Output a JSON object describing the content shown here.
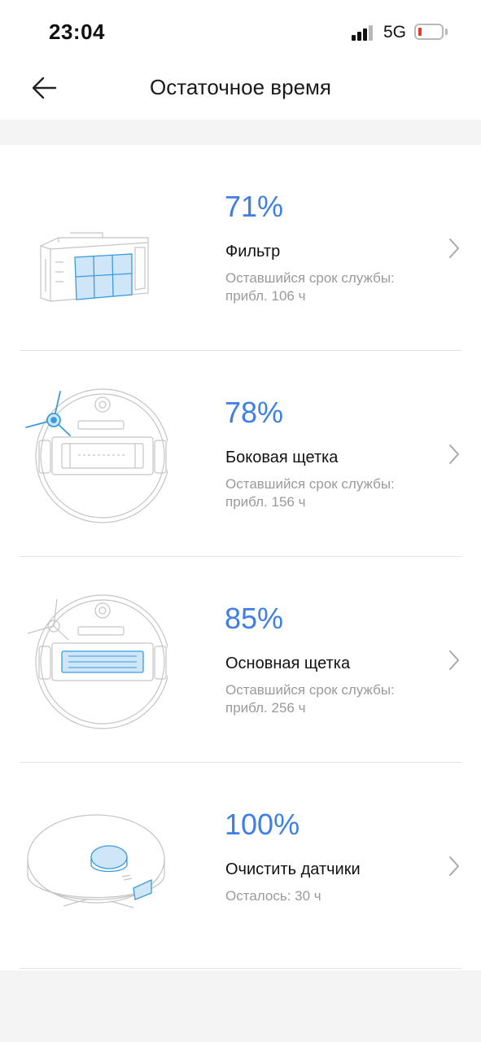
{
  "status_bar": {
    "time": "23:04",
    "network": "5G",
    "battery_level": 0.1,
    "battery_color": "#e23a2e"
  },
  "nav": {
    "title": "Остаточное время",
    "back_icon": "arrow-left-icon"
  },
  "accent_color": "#3d7fe6",
  "items": [
    {
      "percent": "71%",
      "name": "Фильтр",
      "desc": "Оставшийся срок службы: прибл. 106 ч",
      "icon": "filter-icon"
    },
    {
      "percent": "78%",
      "name": "Боковая щетка",
      "desc": "Оставшийся срок службы: прибл. 156 ч",
      "icon": "side-brush-icon"
    },
    {
      "percent": "85%",
      "name": "Основная щетка",
      "desc": "Оставшийся срок службы: прибл. 256 ч",
      "icon": "main-brush-icon"
    },
    {
      "percent": "100%",
      "name": "Очистить датчики",
      "desc": "Осталось: 30 ч",
      "icon": "sensor-icon"
    }
  ]
}
